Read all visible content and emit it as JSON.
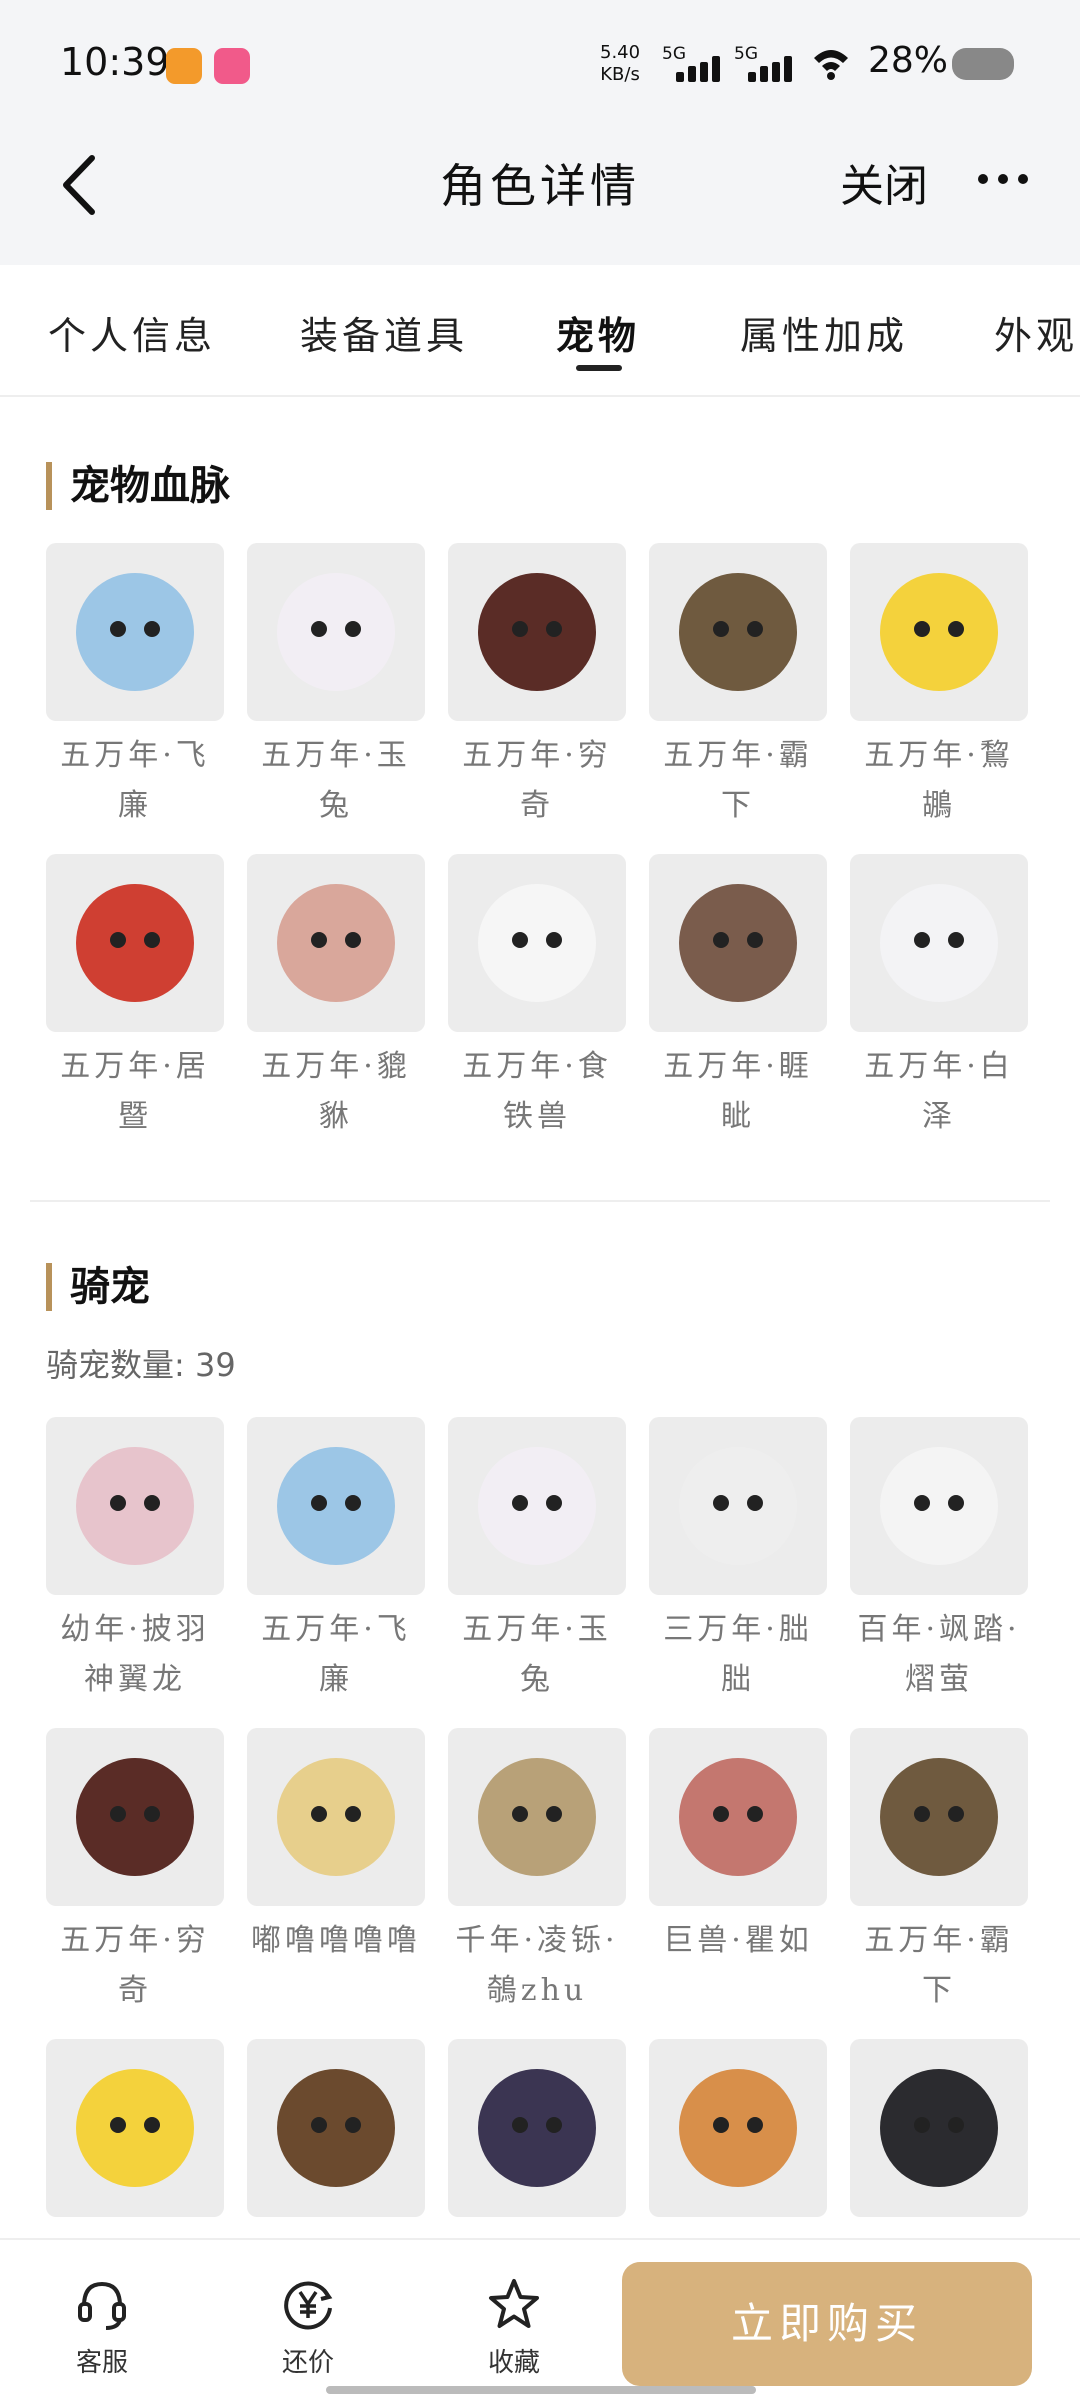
{
  "status_bar": {
    "time": "10:39",
    "speed_value": "5.40",
    "speed_unit": "KB/s",
    "sig1": "5G",
    "sig2": "5G",
    "battery": "28%"
  },
  "header": {
    "title": "角色详情",
    "close_label": "关闭"
  },
  "tabs": [
    {
      "label": "个人信息",
      "active": false
    },
    {
      "label": "装备道具",
      "active": false
    },
    {
      "label": "宠物",
      "active": true
    },
    {
      "label": "属性加成",
      "active": false
    },
    {
      "label": "外观",
      "active": false
    }
  ],
  "pet_bloodline": {
    "title": "宠物血脉",
    "items": [
      {
        "name_line1": "五万年·飞",
        "name_line2": "廉",
        "color": "#9cc6e6"
      },
      {
        "name_line1": "五万年·玉",
        "name_line2": "兔",
        "color": "#f2eef4"
      },
      {
        "name_line1": "五万年·穷",
        "name_line2": "奇",
        "color": "#5a2c26"
      },
      {
        "name_line1": "五万年·霸",
        "name_line2": "下",
        "color": "#6f5a3f"
      },
      {
        "name_line1": "五万年·鵹",
        "name_line2": "鶘",
        "color": "#f4d23c"
      },
      {
        "name_line1": "五万年·居",
        "name_line2": "暨",
        "color": "#cf3f32"
      },
      {
        "name_line1": "五万年·貔",
        "name_line2": "貅",
        "color": "#d9a79b"
      },
      {
        "name_line1": "五万年·食",
        "name_line2": "铁兽",
        "color": "#f6f6f6"
      },
      {
        "name_line1": "五万年·睚",
        "name_line2": "眦",
        "color": "#7a5c4c"
      },
      {
        "name_line1": "五万年·白",
        "name_line2": "泽",
        "color": "#f3f3f5"
      }
    ]
  },
  "mounts": {
    "title": "骑宠",
    "count_label": "骑宠数量:",
    "count_value": "39",
    "items": [
      {
        "name_line1": "幼年·披羽",
        "name_line2": "神翼龙",
        "color": "#e7c4cc"
      },
      {
        "name_line1": "五万年·飞",
        "name_line2": "廉",
        "color": "#9cc6e6"
      },
      {
        "name_line1": "五万年·玉",
        "name_line2": "兔",
        "color": "#f2eef4"
      },
      {
        "name_line1": "三万年·朏",
        "name_line2": "朏",
        "color": "#eeeeee"
      },
      {
        "name_line1": "百年·飒踏·",
        "name_line2": "熠萤",
        "color": "#f4f4f4"
      },
      {
        "name_line1": "五万年·穷",
        "name_line2": "奇",
        "color": "#5a2c26"
      },
      {
        "name_line1": "嘟噜噜噜噜",
        "name_line2": "",
        "color": "#e7cf8c"
      },
      {
        "name_line1": "千年·凌铄·",
        "name_line2": "鵸zhu",
        "color": "#b8a178"
      },
      {
        "name_line1": "巨兽·瞿如",
        "name_line2": "",
        "color": "#c4776f"
      },
      {
        "name_line1": "五万年·霸",
        "name_line2": "下",
        "color": "#6f5a3f"
      },
      {
        "name_line1": "",
        "name_line2": "",
        "color": "#f4d23c"
      },
      {
        "name_line1": "",
        "name_line2": "",
        "color": "#6b4a2e"
      },
      {
        "name_line1": "",
        "name_line2": "",
        "color": "#3b3552"
      },
      {
        "name_line1": "",
        "name_line2": "",
        "color": "#d88f4a"
      },
      {
        "name_line1": "",
        "name_line2": "",
        "color": "#2b2b2f"
      }
    ]
  },
  "bottom_bar": {
    "service_label": "客服",
    "bargain_label": "还价",
    "favorite_label": "收藏",
    "buy_label": "立即购买"
  }
}
